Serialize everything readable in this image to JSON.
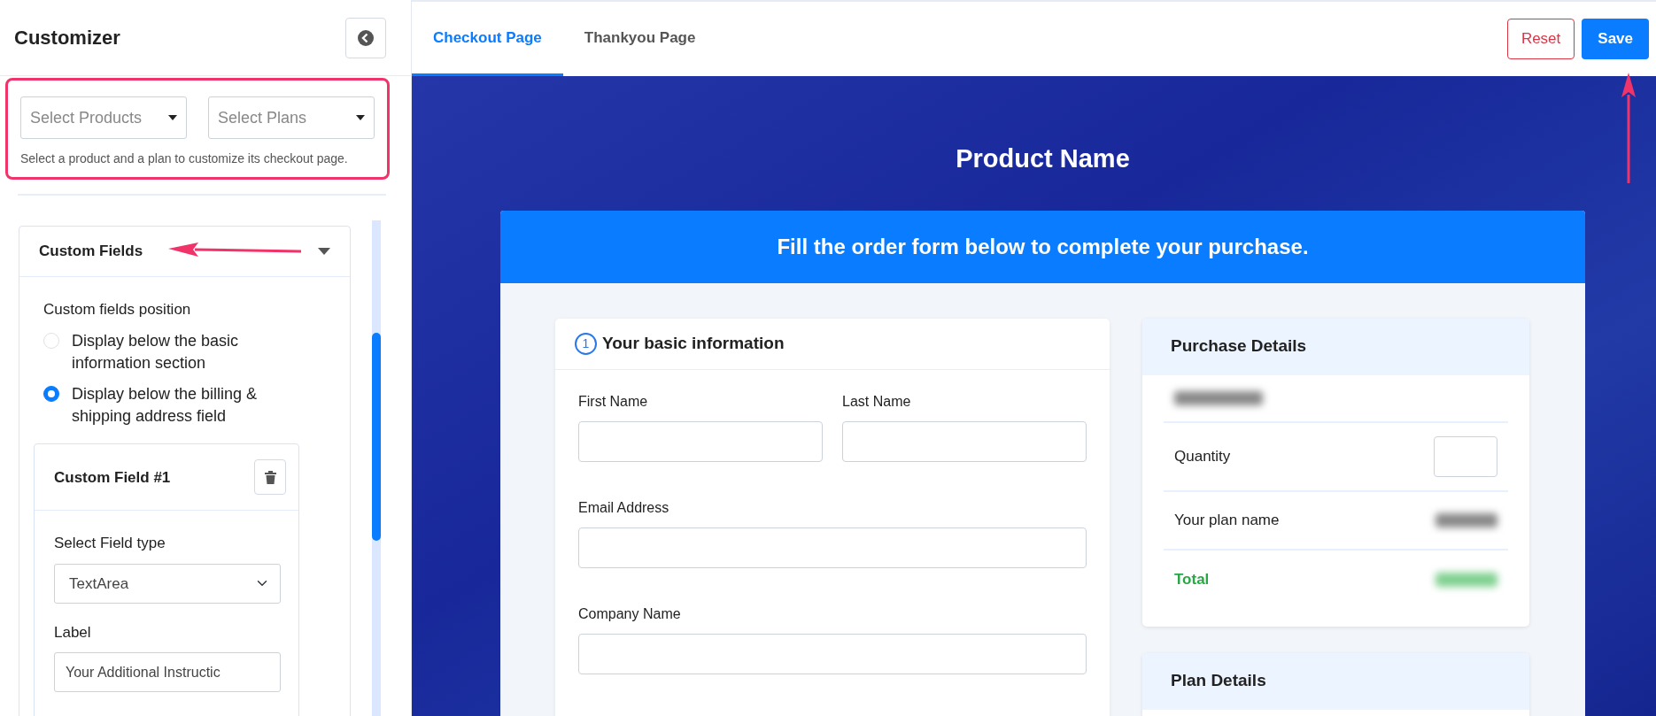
{
  "sidebar": {
    "title": "Customizer",
    "product_select": {
      "placeholder": "Select Products"
    },
    "plan_select": {
      "placeholder": "Select Plans"
    },
    "help_text": "Select a product and a plan to customize its checkout page.",
    "accordion": {
      "title": "Custom Fields",
      "expanded": true,
      "position_label": "Custom fields position",
      "position_options": [
        {
          "label": "Display below the basic information section",
          "selected": false
        },
        {
          "label": "Display below the billing & shipping address field",
          "selected": true
        }
      ],
      "custom_field": {
        "title": "Custom Field #1",
        "field_type_label": "Select Field type",
        "field_type_value": "TextArea",
        "label_label": "Label",
        "label_value": "Your Additional Instructic"
      }
    }
  },
  "tabs": [
    {
      "label": "Checkout Page",
      "selected": true
    },
    {
      "label": "Thankyou Page",
      "selected": false
    }
  ],
  "buttons": {
    "reset": "Reset",
    "save": "Save"
  },
  "preview": {
    "product_name": "Product Name",
    "banner": "Fill the order form below to complete your purchase.",
    "basic_info": {
      "step": "1",
      "title": "Your basic information",
      "rows": [
        [
          {
            "label": "First Name"
          },
          {
            "label": "Last Name"
          }
        ],
        [
          {
            "label": "Email Address"
          }
        ],
        [
          {
            "label": "Company Name"
          }
        ]
      ]
    },
    "purchase_details": {
      "title": "Purchase Details",
      "quantity_label": "Quantity",
      "plan_label": "Your plan name",
      "total_label": "Total"
    },
    "plan_details": {
      "title": "Plan Details"
    }
  }
}
